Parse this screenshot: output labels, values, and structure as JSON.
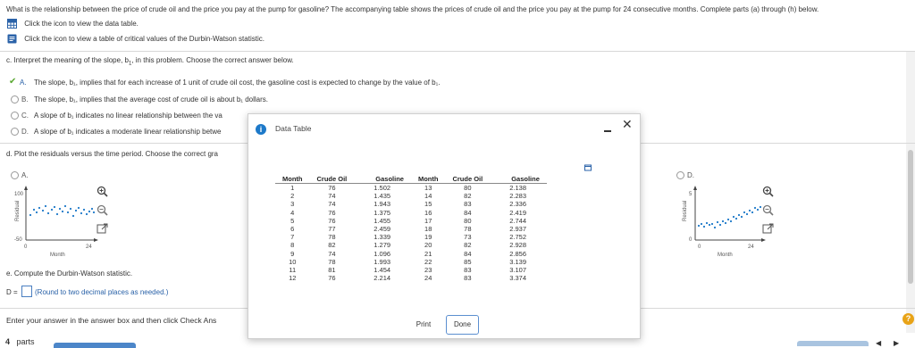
{
  "question": {
    "intro": "What is the relationship between the price of crude oil and the price you pay at the pump for gasoline? The accompanying table shows the prices of crude oil and the price you pay at the pump for 24 consecutive months. Complete parts (a) through (h) below.",
    "link_data": "Click the icon to view the data table.",
    "link_durbin": "Click the icon to view a table of critical values of the Durbin-Watson statistic."
  },
  "part_c": {
    "prompt": "c. Interpret the meaning of the slope, b",
    "prompt_sub": "1",
    "prompt_tail": ", in this problem. Choose the correct answer below.",
    "options": [
      {
        "letter": "A.",
        "text": "The slope, b₁, implies that for each increase of 1 unit of crude oil cost, the gasoline cost is expected to change by the value of b₁."
      },
      {
        "letter": "B.",
        "text": "The slope, b₁, implies that the average cost of crude oil is about b₁ dollars."
      },
      {
        "letter": "C.",
        "text": "A slope of b₁ indicates no linear relationship between the va"
      },
      {
        "letter": "D.",
        "text": "A slope of b₁ indicates a moderate linear relationship betwe"
      }
    ]
  },
  "part_d": {
    "prompt": "d. Plot the residuals versus the time period. Choose the correct gra",
    "option_a": "A.",
    "option_d": "D.",
    "ylabel": "Residual",
    "xlabel": "Month",
    "a_ticks": {
      "y_top": "100",
      "y_bottom": "-50",
      "x_left": "0",
      "x_right": "24"
    },
    "d_ticks": {
      "y_top": "5",
      "y_bottom": "0",
      "x_left": "0",
      "x_right": "24"
    }
  },
  "part_e": {
    "prompt": "e. Compute the Durbin-Watson statistic.",
    "d_label": "D =",
    "hint": "(Round to two decimal places as needed.)"
  },
  "footer": {
    "instruction": "Enter your answer in the answer box and then click Check Ans",
    "parts_num": "4",
    "parts_label": "parts"
  },
  "dialog": {
    "title": "Data Table",
    "columns": [
      "Month",
      "Crude Oil",
      "Gasoline",
      "Month",
      "Crude Oil",
      "Gasoline"
    ],
    "rows": [
      [
        "1",
        "76",
        "1.502",
        "13",
        "80",
        "2.138"
      ],
      [
        "2",
        "74",
        "1.435",
        "14",
        "82",
        "2.283"
      ],
      [
        "3",
        "74",
        "1.943",
        "15",
        "83",
        "2.336"
      ],
      [
        "4",
        "76",
        "1.375",
        "16",
        "84",
        "2.419"
      ],
      [
        "5",
        "76",
        "1.455",
        "17",
        "80",
        "2.744"
      ],
      [
        "6",
        "77",
        "2.459",
        "18",
        "78",
        "2.937"
      ],
      [
        "7",
        "78",
        "1.339",
        "19",
        "73",
        "2.752"
      ],
      [
        "8",
        "82",
        "1.279",
        "20",
        "82",
        "2.928"
      ],
      [
        "9",
        "74",
        "1.096",
        "21",
        "84",
        "2.856"
      ],
      [
        "10",
        "78",
        "1.993",
        "22",
        "85",
        "3.139"
      ],
      [
        "11",
        "81",
        "1.454",
        "23",
        "83",
        "3.107"
      ],
      [
        "12",
        "76",
        "2.214",
        "24",
        "83",
        "3.374"
      ]
    ],
    "print_label": "Print",
    "done_label": "Done"
  },
  "colors": {
    "accent": "#2a62a8",
    "info": "#1d79c9",
    "correct": "#5aa832"
  }
}
